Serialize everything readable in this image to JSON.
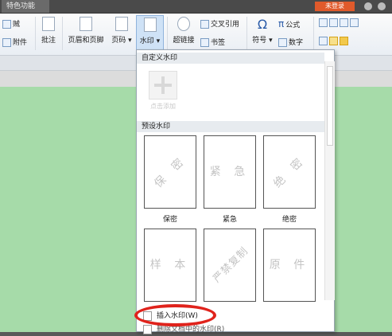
{
  "titlebar": {
    "tab_label": "特色功能",
    "login_label": "未登录"
  },
  "ribbon": {
    "small_left": [
      "贼",
      "附件"
    ],
    "comment": "批注",
    "header_footer": "页眉和页脚",
    "page_number": "页码",
    "watermark": "水印",
    "hyperlink": "超链接",
    "cross_ref": "交叉引用",
    "bookmark": "书签",
    "symbol": "符号",
    "formula": "公式",
    "number": "数字"
  },
  "dropdown": {
    "custom_header": "自定义水印",
    "add_label": "点击添加",
    "preset_header": "预设水印",
    "presets": [
      {
        "text": "保 密",
        "caption": "保密",
        "diagonal": true
      },
      {
        "text": "紧 急",
        "caption": "紧急",
        "diagonal": false
      },
      {
        "text": "绝 密",
        "caption": "绝密",
        "diagonal": true
      },
      {
        "text": "样 本",
        "caption": "",
        "diagonal": false
      },
      {
        "text": "严禁复制",
        "caption": "",
        "diagonal": true
      },
      {
        "text": "原 件",
        "caption": "",
        "diagonal": false
      }
    ],
    "insert_label": "插入水印(W)",
    "remove_label": "删除文档中的水印(R)"
  },
  "colors": {
    "accent_circle": "#e0231c",
    "doc_background": "#a6dba9",
    "login": "#e05a2b"
  }
}
